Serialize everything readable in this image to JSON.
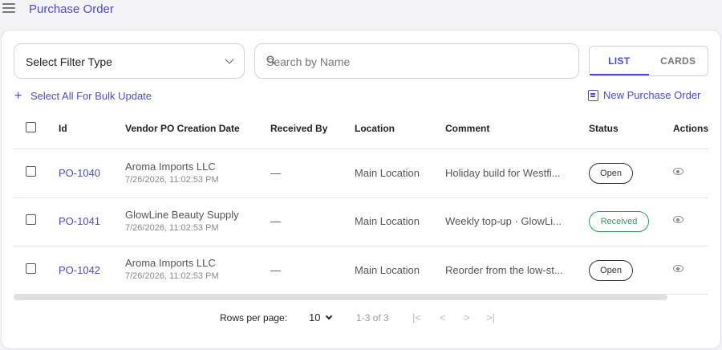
{
  "header": {
    "title": "Purchase Order"
  },
  "toolbar": {
    "filter_label": "Select Filter Type",
    "search_placeholder": "Search by Name",
    "view_tabs": [
      {
        "label": "LIST"
      },
      {
        "label": "CARDS"
      }
    ],
    "bulk_label": "Select All For Bulk Update",
    "new_po_label": "New Purchase Order"
  },
  "table": {
    "columns": [
      "Id",
      "Vendor PO Creation Date",
      "Received By",
      "Location",
      "Comment",
      "Status",
      "Actions"
    ],
    "rows": [
      {
        "id": "PO-1040",
        "vendor": "Aroma Imports LLC",
        "date": "7/26/2026, 11:02:53 PM",
        "received_by": "—",
        "location": "Main Location",
        "comment": "Holiday build for Westfi...",
        "status": "Open"
      },
      {
        "id": "PO-1041",
        "vendor": "GlowLine Beauty Supply",
        "date": "7/26/2026, 11:02:53 PM",
        "received_by": "—",
        "location": "Main Location",
        "comment": "Weekly top-up · GlowLi...",
        "status": "Received"
      },
      {
        "id": "PO-1042",
        "vendor": "Aroma Imports LLC",
        "date": "7/26/2026, 11:02:53 PM",
        "received_by": "—",
        "location": "Main Location",
        "comment": "Reorder from the low-st...",
        "status": "Open"
      }
    ]
  },
  "pagination": {
    "rows_per_page_label": "Rows per page:",
    "rows_per_page_value": "10",
    "range": "1-3 of 3",
    "first": "|<",
    "prev": "<",
    "next": ">",
    "last": ">|"
  },
  "colors": {
    "accent": "#4a4ad6",
    "received": "#2e9e5e"
  }
}
